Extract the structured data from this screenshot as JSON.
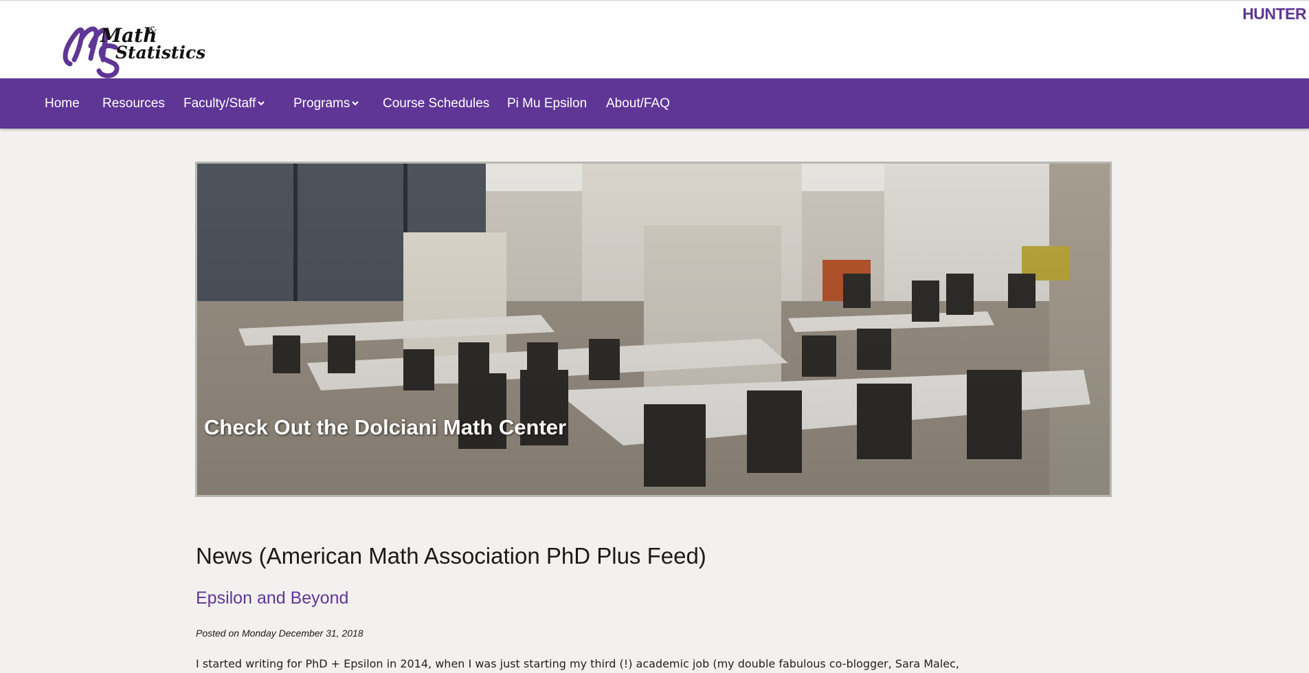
{
  "header": {
    "logo": {
      "line1": "Math",
      "ampersand": "&",
      "line2": "Statistics"
    },
    "institution": "HUNTER"
  },
  "nav": {
    "items": [
      {
        "label": "Home",
        "dropdown": false
      },
      {
        "label": "Resources",
        "dropdown": false
      },
      {
        "label": "Faculty/Staff",
        "dropdown": true
      },
      {
        "label": "Programs",
        "dropdown": true
      },
      {
        "label": "Course Schedules",
        "dropdown": false
      },
      {
        "label": "Pi Mu Epsilon",
        "dropdown": false
      },
      {
        "label": "About/FAQ",
        "dropdown": false
      }
    ]
  },
  "hero": {
    "caption": "Check Out the Dolciani Math Center"
  },
  "news": {
    "heading": "News (American Math Association PhD Plus Feed)",
    "post": {
      "title": "Epsilon and Beyond",
      "date": "Posted on Monday December 31, 2018",
      "excerpt": "I started writing for PhD + Epsilon in 2014, when I was just starting my third (!) academic job (my double fabulous co-blogger, Sara Malec,"
    }
  },
  "colors": {
    "brand_purple": "#5f3696",
    "page_background": "#f3f1ef"
  }
}
